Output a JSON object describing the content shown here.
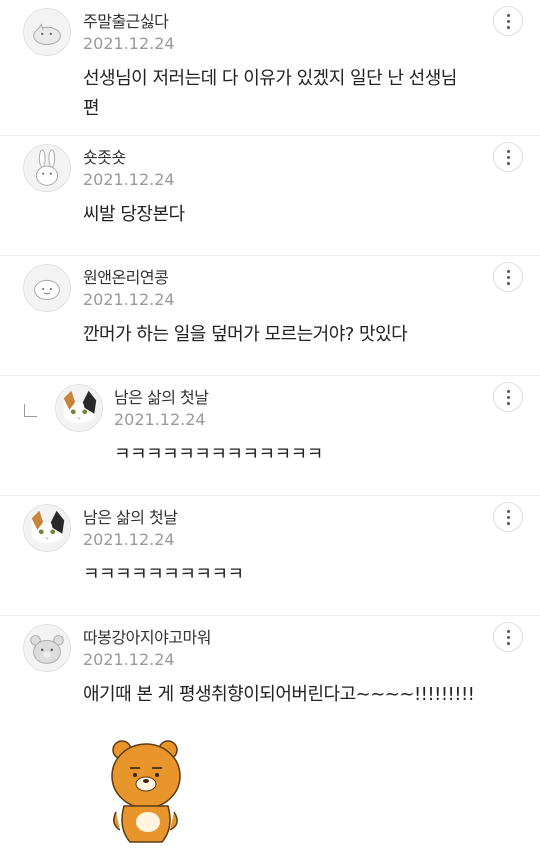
{
  "comments": [
    {
      "nickname": "주말출근싫다",
      "date": "2021.12.24",
      "text_line1": "선생님이 저러는데 다 이유가 있겠지 일단 난 선생님",
      "text_line2": "편"
    },
    {
      "nickname": "숏좃숏",
      "date": "2021.12.24",
      "text": "씨발 당장본다"
    },
    {
      "nickname": "원앤온리연콩",
      "date": "2021.12.24",
      "text": "깐머가 하는 일을 덮머가 모르는거야? 맛있다"
    },
    {
      "nickname": "남은 삶의 첫날",
      "date": "2021.12.24",
      "text": "ㅋㅋㅋㅋㅋㅋㅋㅋㅋㅋㅋㅋㅋ",
      "is_reply": true
    },
    {
      "nickname": "남은 삶의 첫날",
      "date": "2021.12.24",
      "text": "ㅋㅋㅋㅋㅋㅋㅋㅋㅋㅋ"
    },
    {
      "nickname": "따봉강아지야고마워",
      "date": "2021.12.24",
      "text": "애기때 본 게 평생취향이되어버린다고~~~~!!!!!!!!!"
    }
  ],
  "icons": {
    "more": "more-vertical-icon",
    "reply": "reply-arrow-icon"
  }
}
